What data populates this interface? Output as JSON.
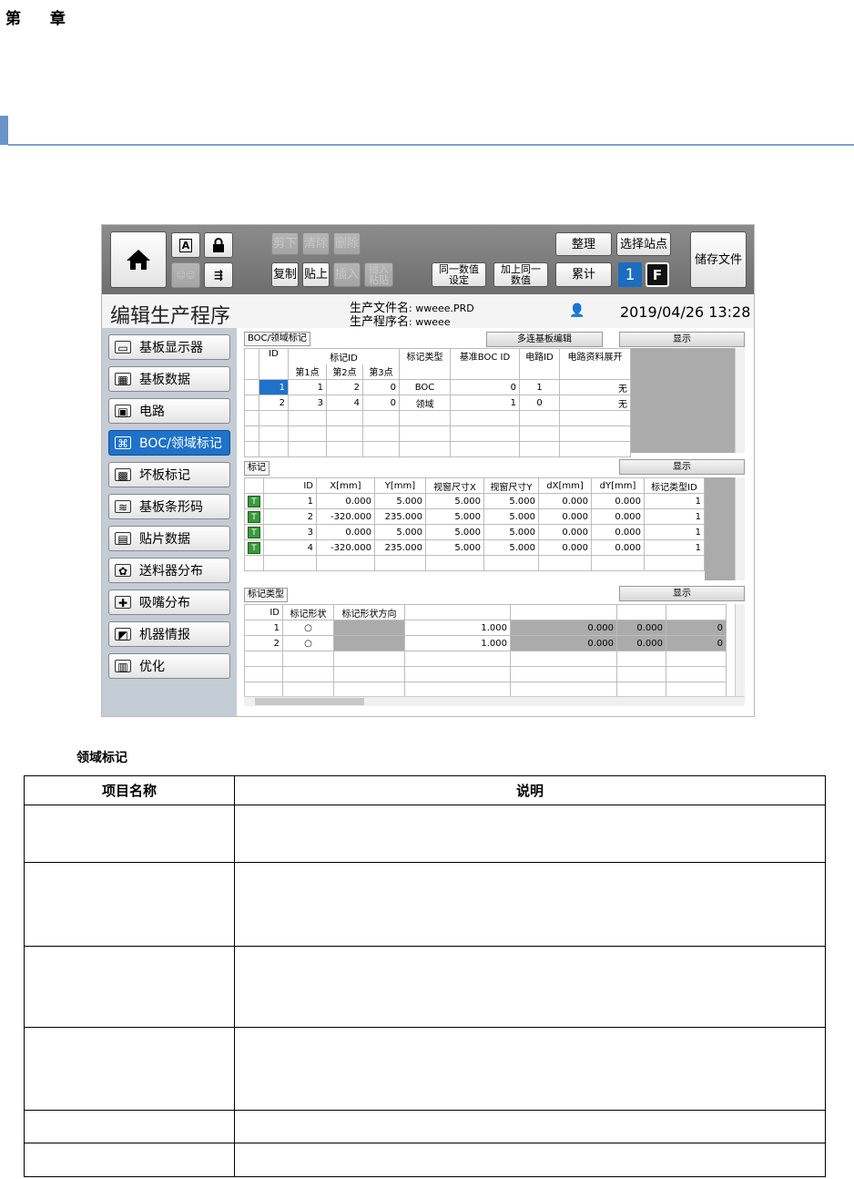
{
  "doc": {
    "chapter": "第 章",
    "caption": "领域标记",
    "table_headers": [
      "项目名称",
      "说明"
    ],
    "table_rows": [
      "",
      "",
      "",
      "",
      "",
      ""
    ]
  },
  "app": {
    "toolbar": {
      "cut": "剪下",
      "clear": "清除",
      "delete": "删除",
      "copy": "复制",
      "paste": "贴上",
      "insert": "插入",
      "insert_paste": "插入\n粘贴",
      "same_value": "同一数值\n设定",
      "add_same": "加上同一\n数值",
      "arrange": "整理",
      "select_station": "选择站点",
      "accumulate": "累计",
      "station_num": "1",
      "f_label": "F",
      "save": "储存文件"
    },
    "title": "编辑生产程序",
    "file_label": "生产文件名",
    "file_value": ": wweee.PRD",
    "program_label": "生产程序名",
    "program_value": ": wweee",
    "datetime": "2019/04/26 13:28",
    "sidebar": [
      {
        "label": "基板显示器",
        "icon": "monitor-icon"
      },
      {
        "label": "基板数据",
        "icon": "board-data-icon"
      },
      {
        "label": "电路",
        "icon": "circuit-icon"
      },
      {
        "label": "BOC/领域标记",
        "icon": "boc-mark-icon"
      },
      {
        "label": "坏板标记",
        "icon": "bad-mark-icon"
      },
      {
        "label": "基板条形码",
        "icon": "barcode-icon"
      },
      {
        "label": "贴片数据",
        "icon": "placement-icon"
      },
      {
        "label": "送料器分布",
        "icon": "feeder-icon"
      },
      {
        "label": "吸嘴分布",
        "icon": "nozzle-icon"
      },
      {
        "label": "机器情报",
        "icon": "machine-icon"
      },
      {
        "label": "优化",
        "icon": "optimize-icon"
      }
    ],
    "boc": {
      "section": "BOC/领域标记",
      "multi_edit": "多连基板编辑",
      "display": "显示",
      "headers": [
        "ID",
        "标记ID",
        "标记类型",
        "基准BOC ID",
        "电路ID",
        "电路资料展开"
      ],
      "sub_headers": [
        "第1点",
        "第2点",
        "第3点"
      ],
      "rows": [
        [
          "1",
          "1",
          "2",
          "0",
          "BOC",
          "0",
          "1",
          "无"
        ],
        [
          "2",
          "3",
          "4",
          "0",
          "领域",
          "1",
          "0",
          "无"
        ]
      ]
    },
    "mark": {
      "section": "标记",
      "display": "显示",
      "headers": [
        "ID",
        "X[mm]",
        "Y[mm]",
        "视窗尺寸X",
        "视窗尺寸Y",
        "dX[mm]",
        "dY[mm]",
        "标记类型ID"
      ],
      "badge": "T",
      "rows": [
        [
          "1",
          "0.000",
          "5.000",
          "5.000",
          "5.000",
          "0.000",
          "0.000",
          "1"
        ],
        [
          "2",
          "-320.000",
          "235.000",
          "5.000",
          "5.000",
          "0.000",
          "0.000",
          "1"
        ],
        [
          "3",
          "0.000",
          "5.000",
          "5.000",
          "5.000",
          "0.000",
          "0.000",
          "1"
        ],
        [
          "4",
          "-320.000",
          "235.000",
          "5.000",
          "5.000",
          "0.000",
          "0.000",
          "1"
        ]
      ]
    },
    "marktype": {
      "section": "标记类型",
      "display": "显示",
      "headers": [
        "ID",
        "标记形状",
        "标记形状方向"
      ],
      "rows": [
        [
          "1",
          "○",
          "",
          "1.000",
          "0.000",
          "0.000",
          "0"
        ],
        [
          "2",
          "○",
          "",
          "1.000",
          "0.000",
          "0.000",
          "0"
        ]
      ]
    }
  }
}
